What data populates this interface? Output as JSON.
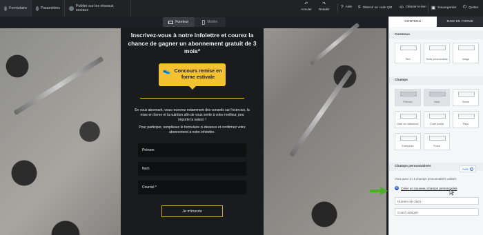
{
  "topbar": {
    "tabs": [
      {
        "label": "Formulaire",
        "icon": "form-icon"
      },
      {
        "label": "Paramètres",
        "icon": "settings-icon"
      },
      {
        "label": "Publier sur les réseaux sociaux",
        "icon": "share-icon"
      }
    ],
    "actions": {
      "undo": {
        "label": "Annuler",
        "icon": "undo-icon"
      },
      "redo": {
        "label": "Rétablir",
        "icon": "redo-icon"
      },
      "help": {
        "label": "Aide",
        "icon": "help-icon"
      },
      "qr": {
        "label": "Obtenir un code QR",
        "icon": "qr-icon"
      },
      "link": {
        "label": "Obtenir le lien",
        "icon": "code-icon"
      },
      "save": {
        "label": "Sauvegarder",
        "icon": "save-icon"
      },
      "quit": {
        "label": "Quitter",
        "icon": "power-icon"
      }
    }
  },
  "device_toggle": {
    "desktop": "Fureteur",
    "mobile": "Mobile"
  },
  "newsletter": {
    "headline": "Inscrivez-vous à notre infolettre et courez la chance de gagner un abonnement gratuit de 3 mois*",
    "badge": "Concours remise en forme estivale",
    "paragraph1": "En vous abonnant, vous recevrez notamment des conseils sur l'exercice, la mise en forme et la nutrition afin de vous sentir à votre meilleur, peu importe la saison !",
    "paragraph2": "Pour participer, remplissez le formulaire ci-dessous et confirmez votre abonnement à notre infolettre.",
    "fields": [
      "Prénom",
      "Nom",
      "Courriel *"
    ],
    "submit": "Je m'inscris"
  },
  "panel": {
    "tabs": [
      "CONTENU",
      "MISE EN FORME"
    ],
    "sections": {
      "content": "Contenus",
      "fields": "Champs",
      "custom": "Champs personnalisés"
    },
    "content_tiles": [
      "Titre",
      "Texte personnalisé",
      "Image"
    ],
    "field_tiles": [
      "Prénom",
      "Nom",
      "Genre",
      "Date de naissance",
      "Code postal",
      "Pays",
      "Entreprise",
      "Poste"
    ],
    "help_button": "Aide",
    "custom_note": "Vous avez 2 / 5 champs personnalisés utilisés",
    "create_link": "Créer un nouveau champs personnalisé",
    "custom_fields": [
      "Numéro de client",
      "Coach assigné"
    ]
  },
  "colors": {
    "accent": "#f2c230",
    "panel_tab": "#2b2d33",
    "link": "#3a6fd8",
    "arrow": "#4caf2a"
  }
}
